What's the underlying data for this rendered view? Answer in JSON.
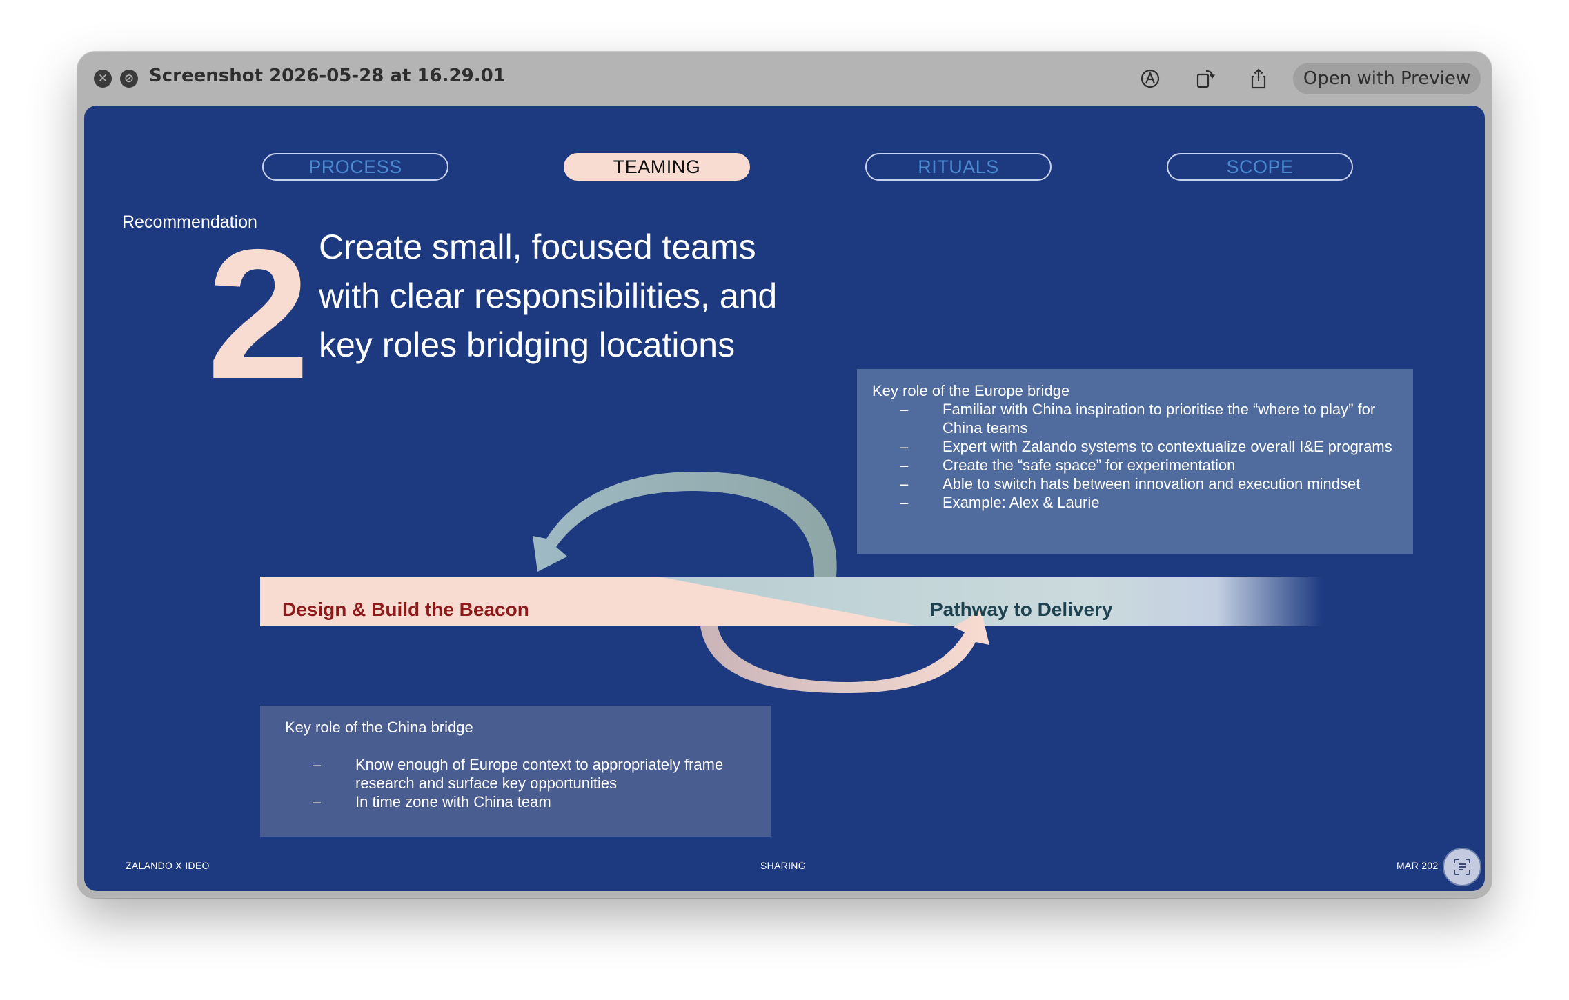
{
  "window": {
    "title": "Screenshot 2026-05-28 at 16.29.01",
    "open_with_label": "Open with Preview",
    "toolbar_icons": [
      "close-icon",
      "edit-icon",
      "markup-icon",
      "rotate-icon",
      "share-icon"
    ]
  },
  "slide": {
    "tabs": [
      {
        "label": "PROCESS",
        "active": false
      },
      {
        "label": "TEAMING",
        "active": true
      },
      {
        "label": "RITUALS",
        "active": false
      },
      {
        "label": "SCOPE",
        "active": false
      }
    ],
    "recommendation_label": "Recommendation",
    "recommendation_number": "2",
    "headline": [
      "Create small, focused teams",
      "with clear responsibilities, and",
      "key roles bridging locations"
    ],
    "europe_box": {
      "title": "Key role of the Europe bridge",
      "dash": "–",
      "items": [
        "Familiar with China inspiration to prioritise the “where to play” for China teams",
        "Expert with Zalando systems to contextualize overall I&E programs",
        "Create the “safe space” for experimentation",
        "Able to switch hats between innovation and execution mindset",
        "Example: Alex & Laurie"
      ]
    },
    "china_box": {
      "title": "Key role of the China bridge",
      "dash": "–",
      "items": [
        "Know enough of Europe context to appropriately frame research and surface key opportunities",
        "In time zone with China team"
      ]
    },
    "diagram": {
      "left_label": "Design & Build the Beacon",
      "right_label": "Pathway to Delivery"
    },
    "footer": {
      "left": "ZALANDO X  IDEO",
      "center": "SHARING",
      "right": "MAR 202"
    }
  },
  "colors": {
    "slide_bg": "#1d3a80",
    "peach": "#f8dcd2",
    "teal": "#a6c2c6",
    "box_europe": "#506b9e",
    "box_china": "#4a5d91",
    "beacon_text": "#8d1a1a",
    "pathway_text": "#1e4250"
  }
}
